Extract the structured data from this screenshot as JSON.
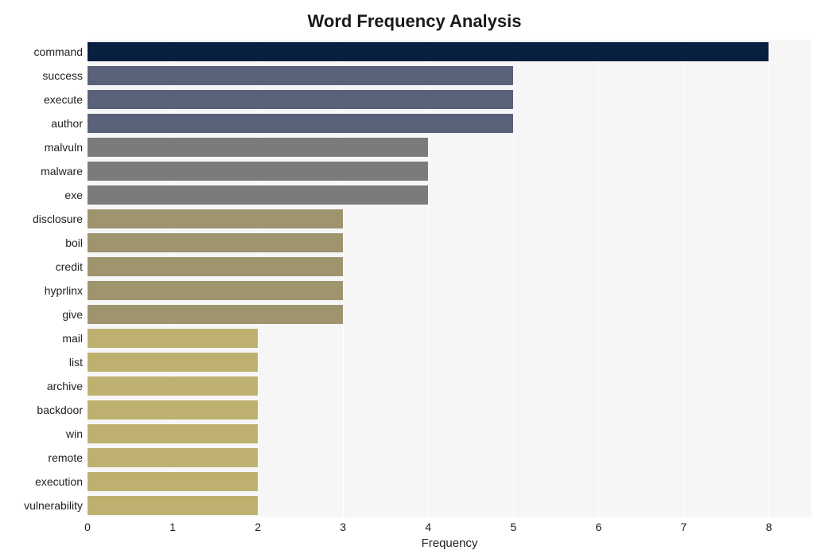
{
  "chart_data": {
    "type": "bar",
    "orientation": "horizontal",
    "title": "Word Frequency Analysis",
    "xlabel": "Frequency",
    "ylabel": "",
    "xlim": [
      0,
      8.5
    ],
    "xticks": [
      0,
      1,
      2,
      3,
      4,
      5,
      6,
      7,
      8
    ],
    "categories": [
      "command",
      "success",
      "execute",
      "author",
      "malvuln",
      "malware",
      "exe",
      "disclosure",
      "boil",
      "credit",
      "hyprlinx",
      "give",
      "mail",
      "list",
      "archive",
      "backdoor",
      "win",
      "remote",
      "execution",
      "vulnerability"
    ],
    "values": [
      8,
      5,
      5,
      5,
      4,
      4,
      4,
      3,
      3,
      3,
      3,
      3,
      2,
      2,
      2,
      2,
      2,
      2,
      2,
      2
    ],
    "colors": [
      "#081f40",
      "#596278",
      "#596278",
      "#596278",
      "#7b7b7b",
      "#7b7b7b",
      "#7b7b7b",
      "#9e946e",
      "#9e946e",
      "#9e946e",
      "#9e946e",
      "#9e946e",
      "#beb06f",
      "#beb06f",
      "#beb06f",
      "#beb06f",
      "#beb06f",
      "#beb06f",
      "#beb06f",
      "#beb06f"
    ]
  }
}
